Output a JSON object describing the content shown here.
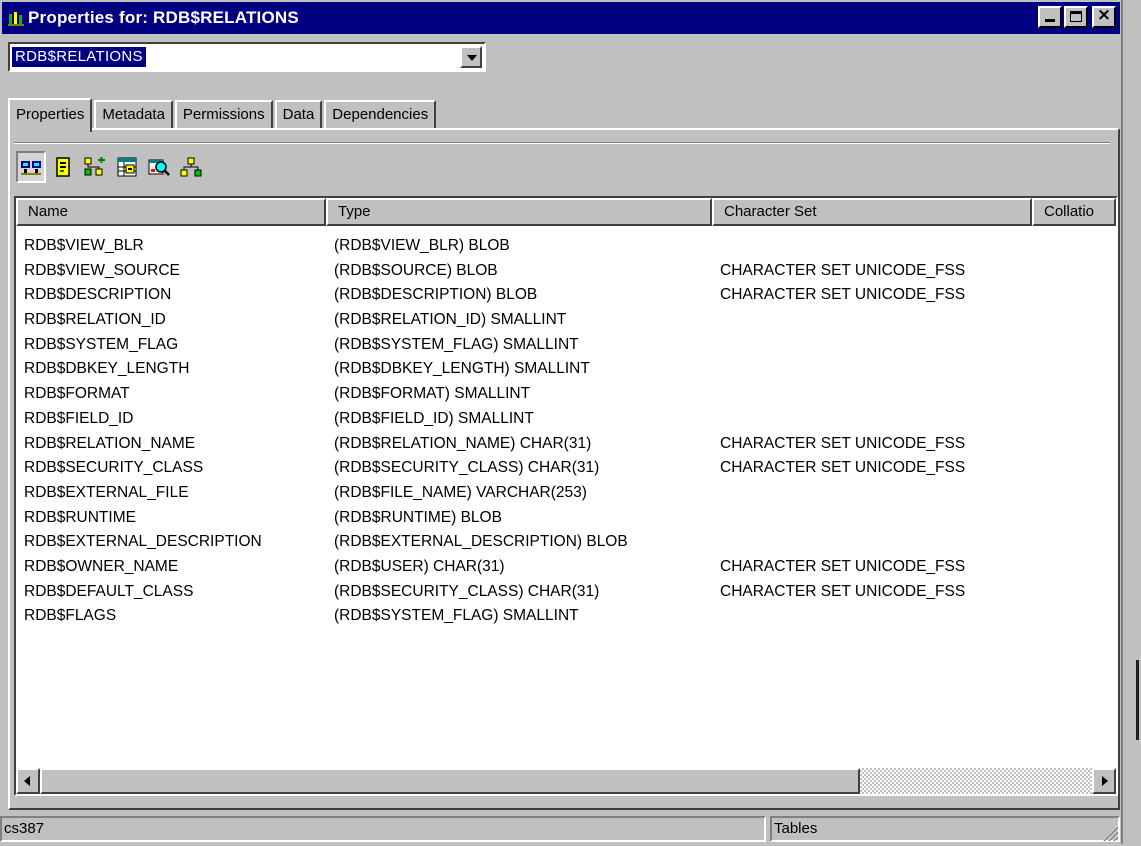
{
  "window": {
    "title": "Properties for: RDB$RELATIONS",
    "icon": "database-app-icon",
    "buttons": [
      "minimize",
      "maximize",
      "close"
    ]
  },
  "object_selector": {
    "value": "RDB$RELATIONS"
  },
  "tabs": [
    {
      "label": "Properties",
      "active": true
    },
    {
      "label": "Metadata",
      "active": false
    },
    {
      "label": "Permissions",
      "active": false
    },
    {
      "label": "Data",
      "active": false
    },
    {
      "label": "Dependencies",
      "active": false
    }
  ],
  "toolbar": {
    "buttons": [
      {
        "icon": "columns-view-icon",
        "pressed": true
      },
      {
        "icon": "document-icon",
        "pressed": false
      },
      {
        "icon": "add-tree-icon",
        "pressed": false
      },
      {
        "icon": "grid-edit-icon",
        "pressed": false
      },
      {
        "icon": "table-search-icon",
        "pressed": false
      },
      {
        "icon": "hierarchy-icon",
        "pressed": false
      }
    ]
  },
  "grid": {
    "columns": [
      "Name",
      "Type",
      "Character Set",
      "Collatio"
    ],
    "rows": [
      [
        "RDB$VIEW_BLR",
        "(RDB$VIEW_BLR) BLOB",
        ""
      ],
      [
        "RDB$VIEW_SOURCE",
        "(RDB$SOURCE) BLOB",
        "CHARACTER SET UNICODE_FSS"
      ],
      [
        "RDB$DESCRIPTION",
        "(RDB$DESCRIPTION) BLOB",
        "CHARACTER SET UNICODE_FSS"
      ],
      [
        "RDB$RELATION_ID",
        "(RDB$RELATION_ID) SMALLINT",
        ""
      ],
      [
        "RDB$SYSTEM_FLAG",
        "(RDB$SYSTEM_FLAG) SMALLINT",
        ""
      ],
      [
        "RDB$DBKEY_LENGTH",
        "(RDB$DBKEY_LENGTH) SMALLINT",
        ""
      ],
      [
        "RDB$FORMAT",
        "(RDB$FORMAT) SMALLINT",
        ""
      ],
      [
        "RDB$FIELD_ID",
        "(RDB$FIELD_ID) SMALLINT",
        ""
      ],
      [
        "RDB$RELATION_NAME",
        "(RDB$RELATION_NAME) CHAR(31)",
        "CHARACTER SET UNICODE_FSS"
      ],
      [
        "RDB$SECURITY_CLASS",
        "(RDB$SECURITY_CLASS) CHAR(31)",
        "CHARACTER SET UNICODE_FSS"
      ],
      [
        "RDB$EXTERNAL_FILE",
        "(RDB$FILE_NAME) VARCHAR(253)",
        ""
      ],
      [
        "RDB$RUNTIME",
        "(RDB$RUNTIME) BLOB",
        ""
      ],
      [
        "RDB$EXTERNAL_DESCRIPTION",
        "(RDB$EXTERNAL_DESCRIPTION) BLOB",
        ""
      ],
      [
        "RDB$OWNER_NAME",
        "(RDB$USER) CHAR(31)",
        "CHARACTER SET UNICODE_FSS"
      ],
      [
        "RDB$DEFAULT_CLASS",
        "(RDB$SECURITY_CLASS) CHAR(31)",
        "CHARACTER SET UNICODE_FSS"
      ],
      [
        "RDB$FLAGS",
        "(RDB$SYSTEM_FLAG) SMALLINT",
        ""
      ]
    ]
  },
  "statusbar": {
    "left": "cs387",
    "right": "Tables"
  },
  "colors": {
    "titlebar": "#000080",
    "face": "#c0c0c0",
    "grid_bg": "#ffffff"
  }
}
